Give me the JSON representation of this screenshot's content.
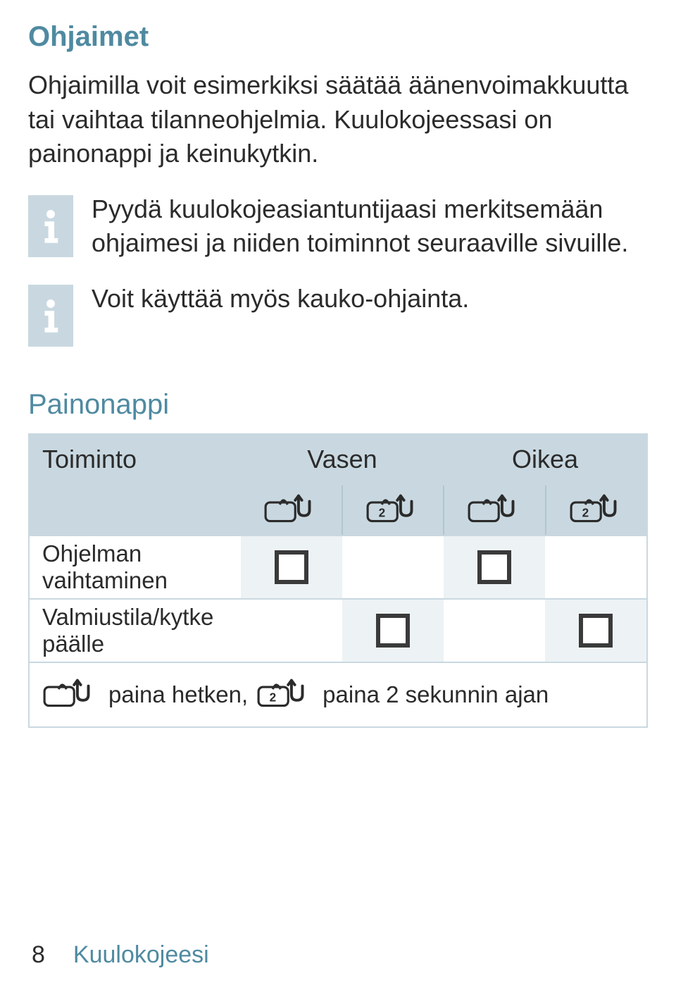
{
  "title": "Ohjaimet",
  "intro": "Ohjaimilla voit esimerkiksi säätää äänenvoimakkuutta tai vaihtaa tilanneohjelmia. Kuulokojeessasi on painonappi ja keinukytkin.",
  "info1": "Pyydä kuulokojeasiantuntijaasi merkitsemään ohjaimesi ja niiden toiminnot seuraaville sivuille.",
  "info2": "Voit käyttää myös kauko-ohjainta.",
  "table_title": "Painonappi",
  "table": {
    "col_function": "Toiminto",
    "col_left": "Vasen",
    "col_right": "Oikea",
    "rows": [
      {
        "label": "Ohjelman vaihtaminen",
        "l1": true,
        "l2": false,
        "r1": true,
        "r2": false
      },
      {
        "label": "Valmiustila/kytke päälle",
        "l1": false,
        "l2": true,
        "r1": false,
        "r2": true
      }
    ]
  },
  "legend": {
    "short": "paina hetken,",
    "long": "paina 2 sekunnin ajan"
  },
  "footer": {
    "page": "8",
    "section": "Kuulokojeesi"
  }
}
